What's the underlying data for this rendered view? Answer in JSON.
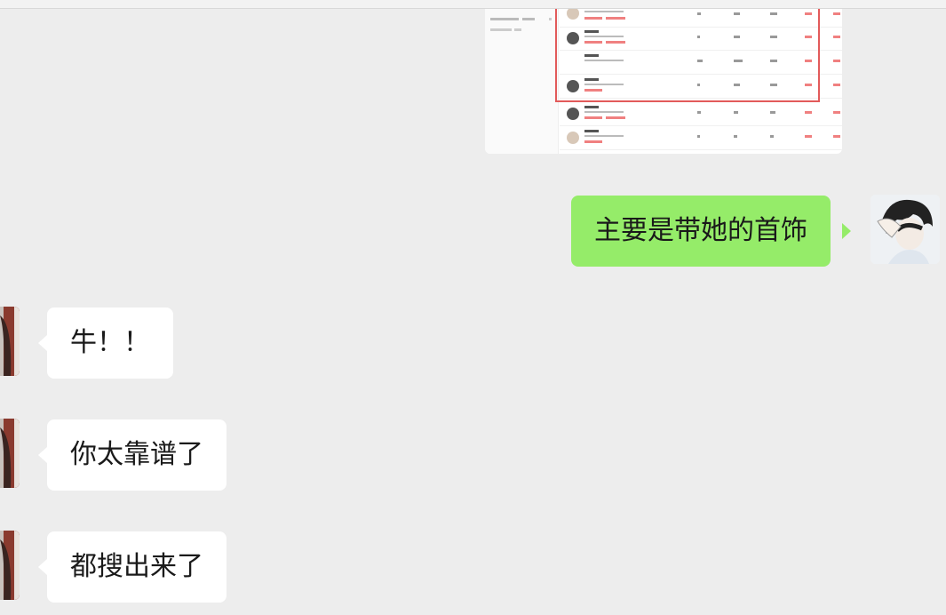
{
  "colors": {
    "background": "#ededed",
    "self_bubble": "#95ec69",
    "other_bubble": "#ffffff",
    "highlight_box": "#e25a5a"
  },
  "shared_image": {
    "description_icon": "screenshot-thumbnail"
  },
  "messages": [
    {
      "sender": "self",
      "text": "主要是带她的首饰"
    },
    {
      "sender": "other",
      "text": "牛！！"
    },
    {
      "sender": "other",
      "text": "你太靠谱了"
    },
    {
      "sender": "other",
      "text": "都搜出来了"
    }
  ]
}
